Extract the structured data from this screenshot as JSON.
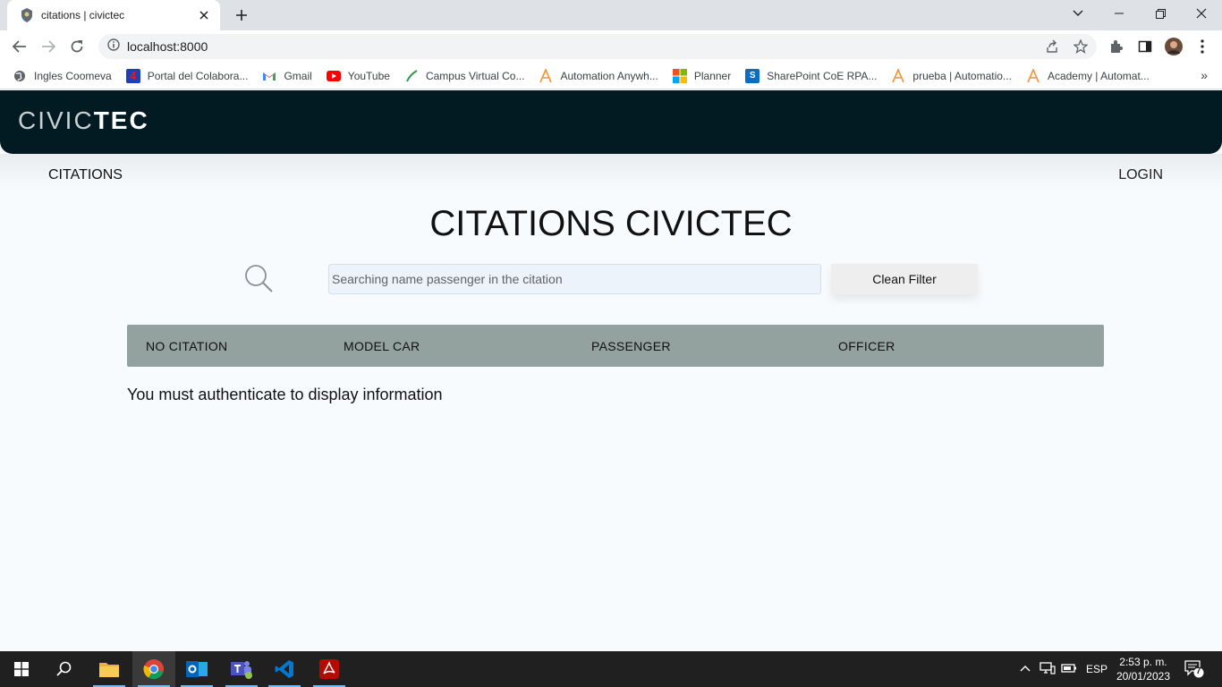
{
  "browser": {
    "tab_title": "citations | civictec",
    "url": "localhost:8000",
    "bookmarks": [
      {
        "label": "Ingles Coomeva",
        "icon": "globe-icon"
      },
      {
        "label": "Portal del Colabora...",
        "icon": "portal-4-icon"
      },
      {
        "label": "Gmail",
        "icon": "gmail-icon"
      },
      {
        "label": "YouTube",
        "icon": "youtube-icon"
      },
      {
        "label": "Campus Virtual Co...",
        "icon": "campus-icon"
      },
      {
        "label": "Automation Anywh...",
        "icon": "automation-anywhere-icon"
      },
      {
        "label": "Planner",
        "icon": "planner-icon"
      },
      {
        "label": "SharePoint CoE RPA...",
        "icon": "sharepoint-icon"
      },
      {
        "label": "prueba | Automatio...",
        "icon": "automation-anywhere-icon"
      },
      {
        "label": "Academy | Automat...",
        "icon": "automation-anywhere-icon"
      }
    ],
    "more_bookmarks": "»"
  },
  "site": {
    "logo_thin": "CIVIC",
    "logo_bold": "TEC",
    "nav_citations": "CITATIONS",
    "nav_login": "LOGIN",
    "page_title": "CITATIONS CIVICTEC",
    "search_placeholder": "Searching name passenger in the citation",
    "search_value": "",
    "clean_filter_label": "Clean Filter",
    "table_columns": [
      "NO CITATION",
      "MODEL CAR",
      "PASSENGER",
      "OFFICER"
    ],
    "auth_message": "You must authenticate to display information"
  },
  "taskbar": {
    "language": "ESP",
    "time": "2:53 p. m.",
    "date": "20/01/2023",
    "notification_count": "7",
    "apps": [
      "windows-start-icon",
      "search-icon",
      "file-explorer-icon",
      "chrome-icon",
      "outlook-icon",
      "teams-icon",
      "vscode-icon",
      "acrobat-icon"
    ]
  },
  "colors": {
    "header_bg": "#021a22",
    "table_header_bg": "#93a19f",
    "page_bg": "#f8fbfe"
  }
}
